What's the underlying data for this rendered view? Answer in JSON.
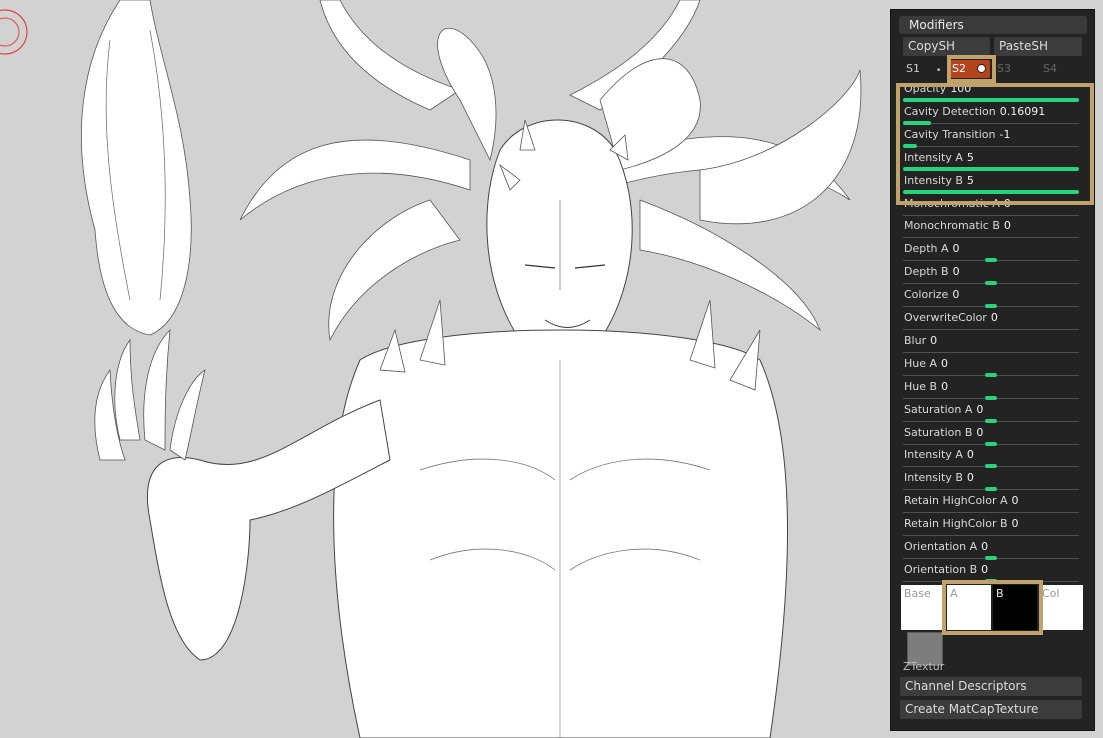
{
  "panel": {
    "title": "Modifiers",
    "copy_label": "CopySH",
    "paste_label": "PasteSH",
    "slots": [
      "S1",
      "S2",
      "S3",
      "S4"
    ],
    "sliders": [
      {
        "label": "Opacity",
        "value": "100",
        "level": 1.0
      },
      {
        "label": "Cavity Detection",
        "value": "0.16091",
        "level": 0.16
      },
      {
        "label": "Cavity Transition",
        "value": "-1",
        "level": 0.08
      },
      {
        "label": "Intensity A",
        "value": "5",
        "level": 1.0
      },
      {
        "label": "Intensity B",
        "value": "5",
        "level": 1.0
      },
      {
        "label": "Monochromatic A",
        "value": "0",
        "level": null
      },
      {
        "label": "Monochromatic B",
        "value": "0",
        "level": null
      },
      {
        "label": "Depth A",
        "value": "0",
        "level": 0.5
      },
      {
        "label": "Depth B",
        "value": "0",
        "level": 0.5
      },
      {
        "label": "Colorize",
        "value": "0",
        "level": 0.5
      },
      {
        "label": "OverwriteColor",
        "value": "0",
        "level": null
      },
      {
        "label": "Blur",
        "value": "0",
        "level": null
      },
      {
        "label": "Hue A",
        "value": "0",
        "level": 0.5
      },
      {
        "label": "Hue B",
        "value": "0",
        "level": 0.5
      },
      {
        "label": "Saturation A",
        "value": "0",
        "level": 0.5
      },
      {
        "label": "Saturation B",
        "value": "0",
        "level": 0.5
      },
      {
        "label": "Intensity A",
        "value": "0",
        "level": 0.5
      },
      {
        "label": "Intensity B",
        "value": "0",
        "level": 0.5
      },
      {
        "label": "Retain HighColor A",
        "value": "0",
        "level": null
      },
      {
        "label": "Retain HighColor B",
        "value": "0",
        "level": null
      },
      {
        "label": "Orientation A",
        "value": "0",
        "level": 0.5
      },
      {
        "label": "Orientation B",
        "value": "0",
        "level": 0.5
      }
    ],
    "swatches": {
      "base": "Base",
      "a": "A",
      "b": "B",
      "col": "Col"
    },
    "ztexture_label": "ZTextur",
    "channel_descriptors_label": "Channel Descriptors",
    "create_matcap_label": "Create MatCapTexture"
  },
  "colors": {
    "accent": "#25d47d",
    "active_slot": "#b4441d",
    "highlight": "#bfa36a"
  }
}
